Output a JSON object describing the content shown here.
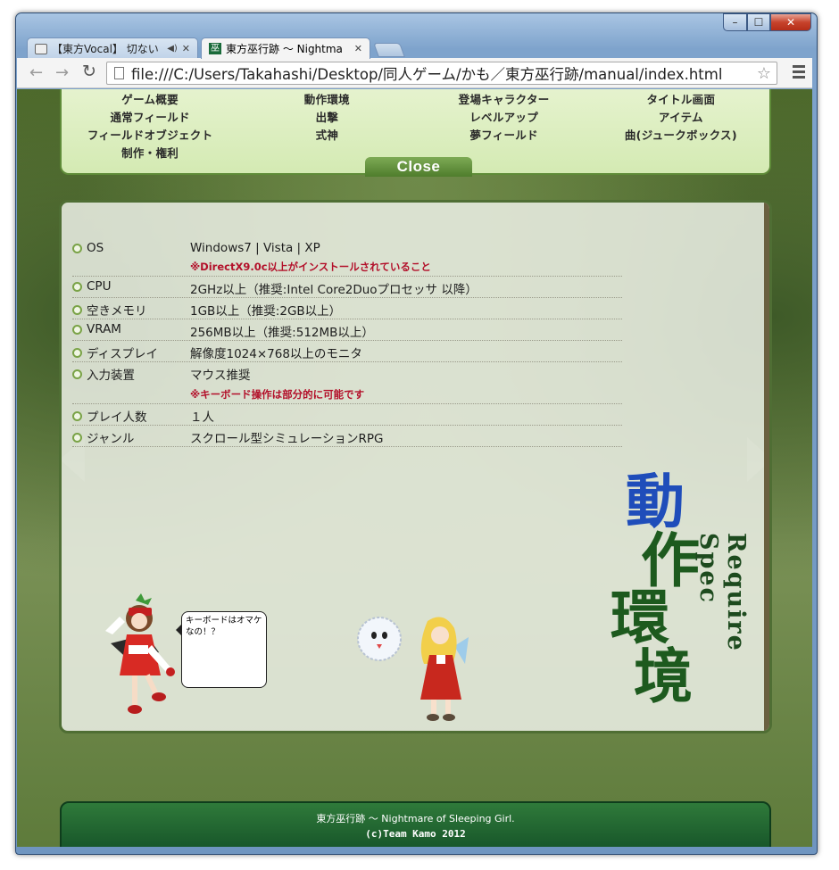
{
  "browser": {
    "tabs": [
      {
        "title": "【東方Vocal】 切ない"
      },
      {
        "title": "東方巫行跡 〜 Nightma"
      }
    ],
    "tab2_favicon": "巫",
    "url": "file:///C:/Users/Takahashi/Desktop/同人ゲーム/かも／東方巫行跡/manual/index.html",
    "icons": {
      "back": "←",
      "forward": "→",
      "reload": "↻",
      "star": "☆",
      "close": "✕",
      "minimize": "–",
      "maximize": "☐",
      "tab_close": "✕",
      "speaker": "◀)"
    }
  },
  "menu": {
    "rows": [
      [
        "ゲーム概要",
        "動作環境",
        "登場キャラクター",
        "タイトル画面"
      ],
      [
        "通常フィールド",
        "出撃",
        "レベルアップ",
        "アイテム"
      ],
      [
        "フィールドオブジェクト",
        "式神",
        "夢フィールド",
        "曲(ジュークボックス)"
      ],
      [
        "制作・権利",
        "",
        "",
        ""
      ]
    ],
    "close_label": "Close"
  },
  "specs": [
    {
      "label": "OS",
      "value": "Windows7 | Vista | XP",
      "note": "※DirectX9.0c以上がインストールされていること"
    },
    {
      "label": "CPU",
      "value": "2GHz以上（推奨:Intel Core2Duoプロセッサ 以降）",
      "note": ""
    },
    {
      "label": "空きメモリ",
      "value": "1GB以上（推奨:2GB以上）",
      "note": ""
    },
    {
      "label": "VRAM",
      "value": "256MB以上（推奨:512MB以上）",
      "note": ""
    },
    {
      "label": "ディスプレイ",
      "value": "解像度1024×768以上のモニタ",
      "note": ""
    },
    {
      "label": "入力装置",
      "value": "マウス推奨",
      "note": "※キーボード操作は部分的に可能です"
    },
    {
      "label": "プレイ人数",
      "value": "１人",
      "note": ""
    },
    {
      "label": "ジャンル",
      "value": "スクロール型シミュレーションRPG",
      "note": ""
    }
  ],
  "title_art": {
    "kanji": [
      "動",
      "作",
      "環",
      "境"
    ],
    "subtitle": "Require Spec"
  },
  "bubble_text": "キーボードはオマケなの！？",
  "footer": {
    "line1": "東方巫行跡 〜 Nightmare of Sleeping Girl.",
    "line2": "(c)Team Kamo 2012"
  },
  "colors": {
    "menu_bg": "#dcefc2",
    "footer_bg": "#1e6630",
    "note_red": "#b3102a",
    "kanji_blue": "#1f4dba",
    "kanji_green": "#1d5a1e"
  }
}
